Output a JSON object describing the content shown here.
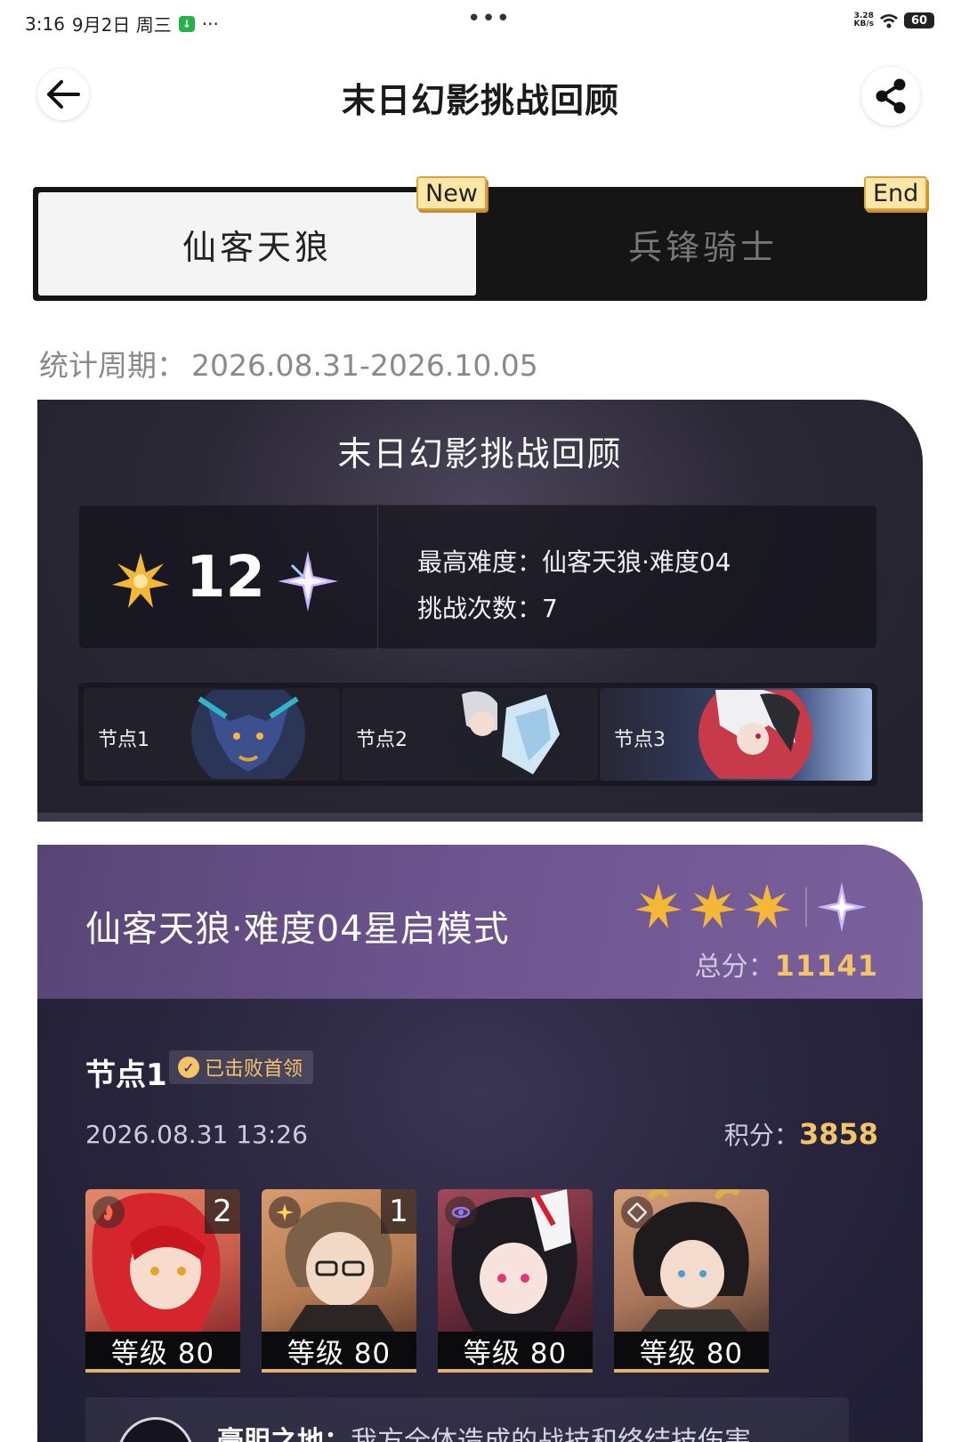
{
  "status_bar": {
    "time": "3:16",
    "date": "9月2日 周三",
    "extra": "···",
    "center_menu": "•••",
    "net_speed_value": "3.28",
    "net_speed_unit": "KB/s",
    "battery": "60"
  },
  "header": {
    "title": "末日幻影挑战回顾"
  },
  "tabs": [
    {
      "label": "仙客天狼",
      "badge": "New",
      "active": true
    },
    {
      "label": "兵锋骑士",
      "badge": "End",
      "active": false
    }
  ],
  "period": {
    "label": "统计周期：",
    "value": "2026.08.31-2026.10.05"
  },
  "summary": {
    "title": "末日幻影挑战回顾",
    "stars": "12",
    "max_difficulty_label": "最高难度：",
    "max_difficulty_value": "仙客天狼·难度04",
    "attempts_label": "挑战次数：",
    "attempts_value": "7",
    "nodes": [
      {
        "label": "节点1"
      },
      {
        "label": "节点2"
      },
      {
        "label": "节点3"
      }
    ]
  },
  "detail": {
    "title": "仙客天狼·难度04星启模式",
    "stars_earned": 3,
    "score_label": "总分：",
    "score_value": "11141",
    "node": {
      "title": "节点1",
      "defeated_label": "已击败首领",
      "time": "2026.08.31 13:26",
      "score_label": "积分：",
      "score_value": "3858",
      "characters": [
        {
          "level": "等级 80",
          "eidolon": "2",
          "element": "fire-element-icon"
        },
        {
          "level": "等级 80",
          "eidolon": "1",
          "element": "imaginary-element-icon"
        },
        {
          "level": "等级 80",
          "eidolon": "",
          "element": "quantum-element-icon"
        },
        {
          "level": "等级 80",
          "eidolon": "",
          "element": "physical-element-icon"
        }
      ]
    },
    "buff": {
      "name": "豪胆之地：",
      "desc": "我方全体造成的战技和终结技伤害"
    }
  },
  "colors": {
    "accent_gold": "#f3c46a",
    "badge_bg": "#fde6a8",
    "card_purple": "#6e5590"
  }
}
